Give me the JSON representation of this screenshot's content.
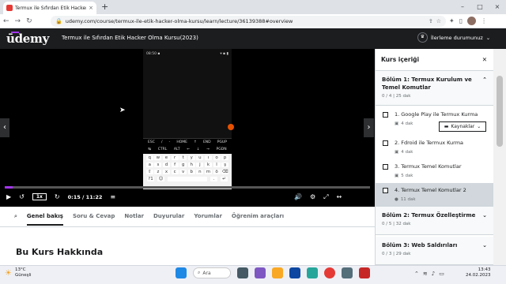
{
  "browser": {
    "tab_title": "Termux ile Sıfırdan Etik Hacker O",
    "tab_close": "×",
    "new_tab": "+",
    "url": "udemy.com/course/termux-ile-etik-hacker-olma-kursu/learn/lecture/36139388#overview",
    "window": {
      "minimize": "–",
      "maximize": "□",
      "close": "×"
    }
  },
  "header": {
    "logo": "ūdemy",
    "course_title": "Termux ile Sıfırdan Etik Hacker Olma Kursu(2023)",
    "progress_label": "İlerleme durumunuz",
    "progress_chevron": "⌄"
  },
  "player": {
    "speed": "1x",
    "time": "0:15 / 11:22",
    "progress_fraction": 0.022,
    "phone": {
      "status_left": "08:50 ▪",
      "status_right": "▾ ▪ ▮",
      "extra_keys_row1": [
        "ESC",
        "/",
        "-",
        "HOME",
        "↑",
        "END",
        "PGUP"
      ],
      "extra_keys_row2": [
        "↹",
        "CTRL",
        "ALT",
        "←",
        "↓",
        "→",
        "PGDN"
      ],
      "keyboard_rows": [
        [
          "q",
          "w",
          "e",
          "r",
          "t",
          "y",
          "u",
          "ı",
          "o",
          "p"
        ],
        [
          "a",
          "s",
          "d",
          "f",
          "g",
          "h",
          "j",
          "k",
          "l",
          "ş"
        ],
        [
          "⇧",
          "z",
          "x",
          "c",
          "v",
          "b",
          "n",
          "m",
          "ö",
          "⌫"
        ]
      ]
    }
  },
  "tabs": [
    {
      "label": "Genel bakış",
      "active": true
    },
    {
      "label": "Soru & Cevap",
      "active": false
    },
    {
      "label": "Notlar",
      "active": false
    },
    {
      "label": "Duyurular",
      "active": false
    },
    {
      "label": "Yorumlar",
      "active": false
    },
    {
      "label": "Öğrenim araçları",
      "active": false
    }
  ],
  "about_heading": "Bu Kurs Hakkında",
  "sidebar": {
    "title": "Kurs içeriği",
    "close": "✕",
    "sections": [
      {
        "title": "Bölüm 1: Termux Kurulum ve Temel Komutlar",
        "title_line1": "Bölüm 1: Termux Kurulum ve",
        "title_line2": "Temel Komutlar",
        "meta": "0 / 4 | 25 dak",
        "chevron": "⌃"
      },
      {
        "title": "Bölüm 2: Termux Özelleştirme",
        "meta": "0 / 5 | 32 dak",
        "chevron": "⌄"
      },
      {
        "title": "Bölüm 3: Web Saldırıları",
        "meta": "0 / 3 | 29 dak",
        "chevron": "⌄"
      }
    ],
    "lessons": [
      {
        "title": "1. Google Play ile Termux Kurma",
        "duration": "4 dak"
      },
      {
        "title": "2. Fdroid ile Termux Kurma",
        "duration": "4 dak"
      },
      {
        "title": "3. Termux Temel Komutlar",
        "duration": "5 dak"
      },
      {
        "title": "4. Termux Temel Komutlar 2",
        "duration": "11 dak"
      }
    ],
    "resources_label": "Kaynaklar"
  },
  "taskbar": {
    "weather_temp": "13°C",
    "weather_desc": "Güneşli",
    "search": "Ara",
    "time": "13:43",
    "date": "24.02.2023"
  }
}
